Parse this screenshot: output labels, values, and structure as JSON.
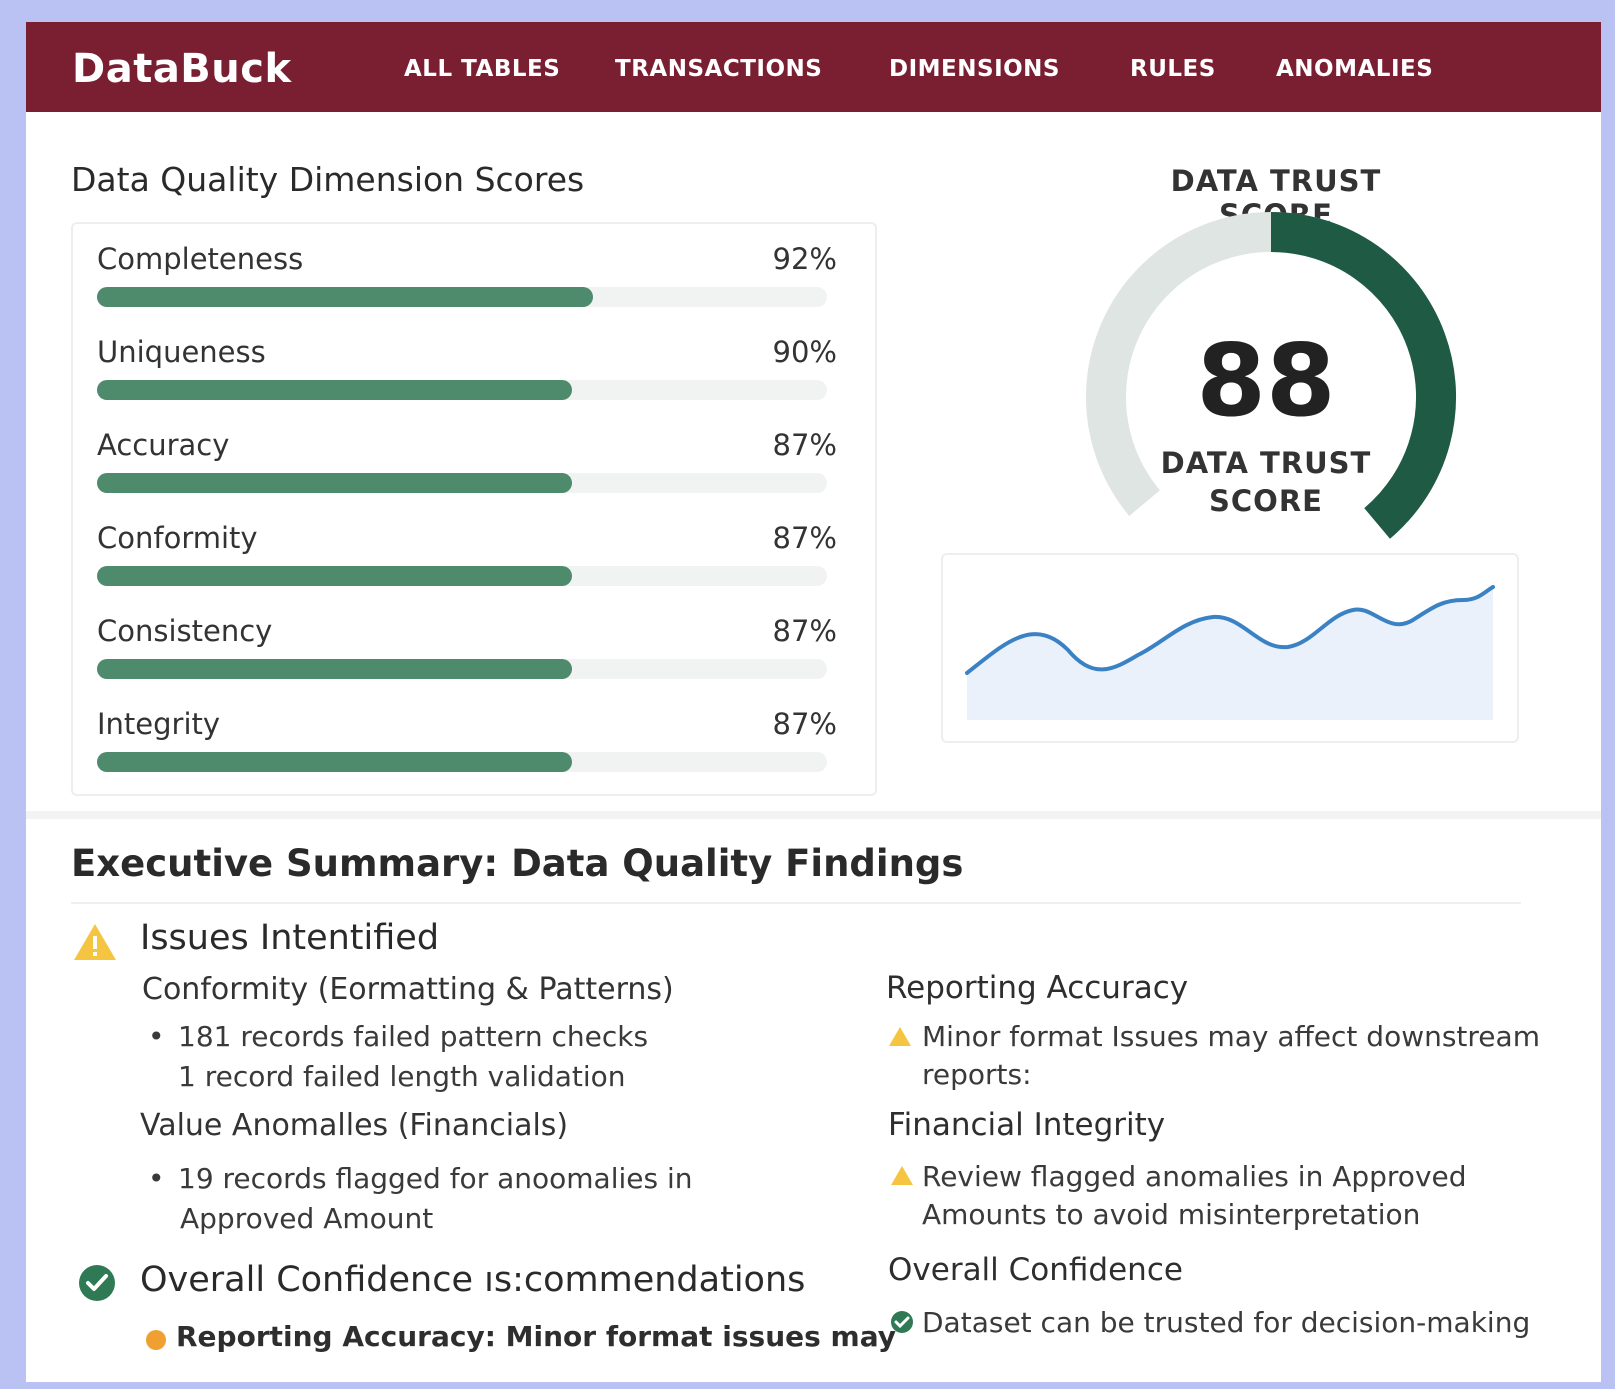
{
  "nav": {
    "logo": "DataBuck",
    "items": [
      "ALL TABLES",
      "TRANSACTIONS",
      "DIMENSIONS",
      "RULES",
      "ANOMALIES"
    ]
  },
  "dimensions": {
    "title": "Data Quality Dimension Scores",
    "items": [
      {
        "label": "Completeness",
        "pct_text": "92%",
        "value": 68
      },
      {
        "label": "Uniqueness",
        "pct_text": "90%",
        "value": 65
      },
      {
        "label": "Accuracy",
        "pct_text": "87%",
        "value": 65
      },
      {
        "label": "Conformity",
        "pct_text": "87%",
        "value": 65
      },
      {
        "label": "Consistency",
        "pct_text": "87%",
        "value": 65
      },
      {
        "label": "Integrity",
        "pct_text": "87%",
        "value": 65
      }
    ]
  },
  "trust": {
    "title": "DATA TRUST SCORE",
    "value": "88",
    "label_line1": "DATA TRUST",
    "label_line2": "SCORE",
    "score_value": 88,
    "colors": {
      "fill": "#1f5a45",
      "track": "#dfe5e2"
    }
  },
  "trend": {
    "line_color": "#3b82c4",
    "area_color": "#eaf1fa"
  },
  "summary": {
    "title": "Executive Summary: Data Quality Findings",
    "issues_heading": "Issues Intentified",
    "conformity_heading": "Conformity (Eormatting & Patterns)",
    "conformity_bullet1": "181 records failed pattern checks",
    "conformity_bullet2": "1 record failed length validation",
    "anomalies_heading": "Value Anomalles (Financials)",
    "anomalies_bullet1": "19 records flagged for anoomalies in",
    "anomalies_bullet2": "Approved Amount",
    "confidence_heading": "Overall Confidence ıs:commendations",
    "confidence_bullet": "Reporting Accuracy: Minor format issues may",
    "reporting_heading": "Reporting Accuracy",
    "reporting_line1": "Minor format Issues may affect downstream",
    "reporting_line2": "reports:",
    "financial_heading": "Financial Integrity",
    "financial_line1": "Review flagged anomalies in Approved",
    "financial_line2": "Amounts to avoid misinterpretation",
    "overall_heading": "Overall Confidence",
    "overall_line": "Dataset can be trusted for decision-making",
    "bullet_char": "•"
  }
}
